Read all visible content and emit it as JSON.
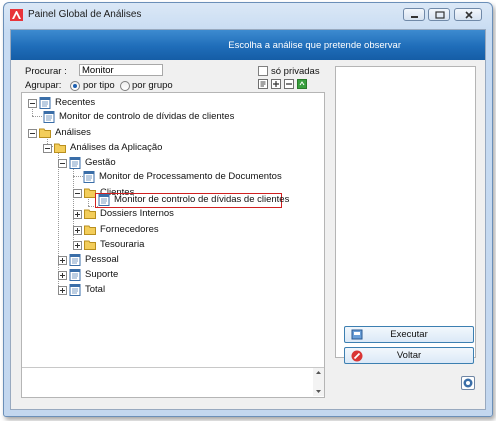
{
  "window": {
    "title": "Painel Global de Análises",
    "banner_text": "Escolha a análise que pretende observar"
  },
  "search": {
    "label": "Procurar :",
    "value": "Monitor",
    "private_only_label": "só privadas",
    "private_only_checked": false
  },
  "grouping": {
    "label": "Agrupar:",
    "options": [
      {
        "label": "por tipo",
        "selected": true
      },
      {
        "label": "por grupo",
        "selected": false
      }
    ]
  },
  "tree": {
    "nodes": [
      {
        "label": "Recentes",
        "icon": "list-icon",
        "expanded": true,
        "level": 0
      },
      {
        "label": "Monitor de controlo de dívidas de clientes",
        "icon": "list-icon",
        "level": 1
      },
      {
        "label": "Análises",
        "icon": "folder-icon",
        "expanded": true,
        "level": 0
      },
      {
        "label": "Análises da Aplicação",
        "icon": "folder-icon",
        "expanded": true,
        "level": 1
      },
      {
        "label": "Gestão",
        "icon": "list-icon",
        "expanded": true,
        "level": 2
      },
      {
        "label": "Monitor de Processamento de Documentos",
        "icon": "list-icon",
        "level": 3
      },
      {
        "label": "Clientes",
        "icon": "folder-icon",
        "expanded": true,
        "level": 3
      },
      {
        "label": "Monitor de controlo de dívidas de clientes",
        "icon": "list-icon",
        "level": 4,
        "selected": true
      },
      {
        "label": "Dossiers Internos",
        "icon": "folder-icon",
        "expanded": false,
        "level": 3
      },
      {
        "label": "Fornecedores",
        "icon": "folder-icon",
        "expanded": false,
        "level": 3
      },
      {
        "label": "Tesouraria",
        "icon": "folder-icon",
        "expanded": false,
        "level": 3
      },
      {
        "label": "Pessoal",
        "icon": "list-icon",
        "expanded": false,
        "level": 2
      },
      {
        "label": "Suporte",
        "icon": "list-icon",
        "expanded": false,
        "level": 2
      },
      {
        "label": "Total",
        "icon": "list-icon",
        "expanded": false,
        "level": 2
      }
    ]
  },
  "buttons": {
    "execute": "Executar",
    "back": "Voltar"
  },
  "colors": {
    "banner": "#1f6db9",
    "selection_border": "#d02020",
    "folder": "#f0c44c"
  }
}
